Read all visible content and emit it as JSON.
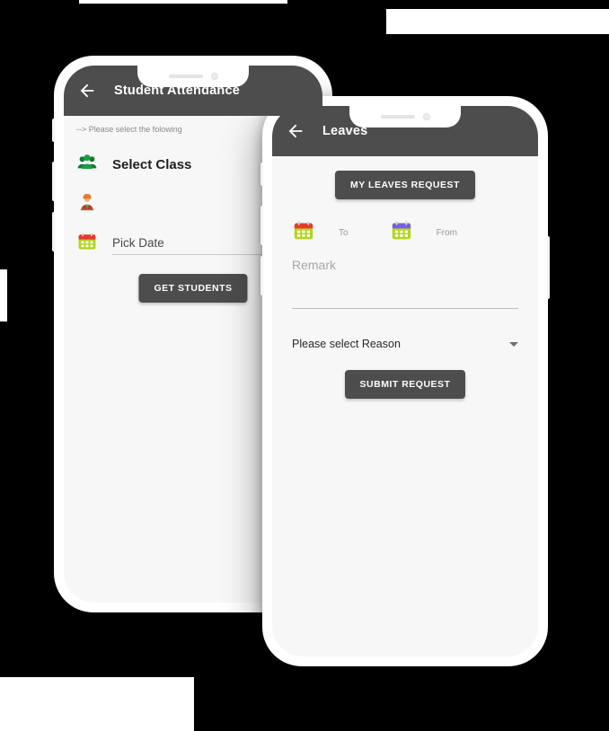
{
  "scene": {
    "background_color": "#000000",
    "device_frame_color": "#ffffff",
    "appbar_color": "#4d4d4d",
    "screen_color": "#f7f7f7",
    "button_color": "#4d4d4d"
  },
  "phone_back": {
    "appbar": {
      "back_icon": "back-arrow-icon",
      "title": "Student Attendance"
    },
    "hint": "--> Please select the folowing",
    "rows": [
      {
        "icon": "group-people-icon",
        "label": "Select Class"
      },
      {
        "icon": "student-person-icon",
        "label": ""
      },
      {
        "icon": "calendar-red-icon",
        "field_placeholder": "Pick Date"
      }
    ],
    "primary_button": "GET STUDENTS"
  },
  "phone_front": {
    "appbar": {
      "back_icon": "back-arrow-icon",
      "title": "Leaves"
    },
    "my_leaves_button": "MY LEAVES REQUEST",
    "dates": [
      {
        "icon": "calendar-red-icon",
        "label": "To"
      },
      {
        "icon": "calendar-purple-icon",
        "label": "From"
      }
    ],
    "remark_placeholder": "Remark",
    "reason_select": {
      "value": "Please select Reason",
      "caret_icon": "chevron-down-icon"
    },
    "submit_button": "SUBMIT REQUEST"
  }
}
